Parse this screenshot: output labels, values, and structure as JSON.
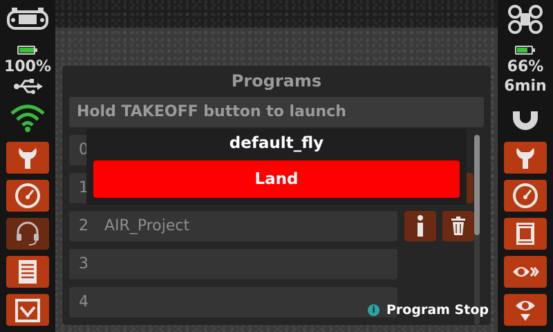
{
  "left_panel": {
    "battery_percent_text": "100%",
    "battery_level": 0.95,
    "icons": [
      "gamepad-icon",
      "battery-icon",
      "usb-icon",
      "wifi-icon"
    ],
    "buttons": [
      {
        "name": "wrench-icon"
      },
      {
        "name": "gauge-icon"
      },
      {
        "name": "headset-icon"
      },
      {
        "name": "document-icon"
      },
      {
        "name": "tray-down-icon"
      }
    ]
  },
  "right_panel": {
    "battery_percent_text": "66%",
    "flight_time_text": "6min",
    "battery_level": 0.66,
    "icons": [
      "drone-icon",
      "battery-icon",
      "magnet-icon"
    ],
    "buttons": [
      {
        "name": "wrench-icon"
      },
      {
        "name": "gauge-icon"
      },
      {
        "name": "chip-icon"
      },
      {
        "name": "eye-arrows-icon"
      },
      {
        "name": "eye-down-icon"
      }
    ]
  },
  "dialog": {
    "title": "Programs",
    "hint": "Hold TAKEOFF button to launch",
    "programs": [
      {
        "num": "0",
        "name": ""
      },
      {
        "num": "1",
        "name": ""
      },
      {
        "num": "2",
        "name": "AIR_Project"
      },
      {
        "num": "3",
        "name": ""
      },
      {
        "num": "4",
        "name": ""
      }
    ]
  },
  "popup": {
    "title": "default_fly",
    "land_label": "Land"
  },
  "footer": {
    "info_icon": "info-icon",
    "program_stop_label": "Program Stop"
  },
  "colors": {
    "accent": "#b83a12",
    "accent_dim": "#6a2b12",
    "danger": "#ff0000",
    "ok": "#39c239"
  }
}
